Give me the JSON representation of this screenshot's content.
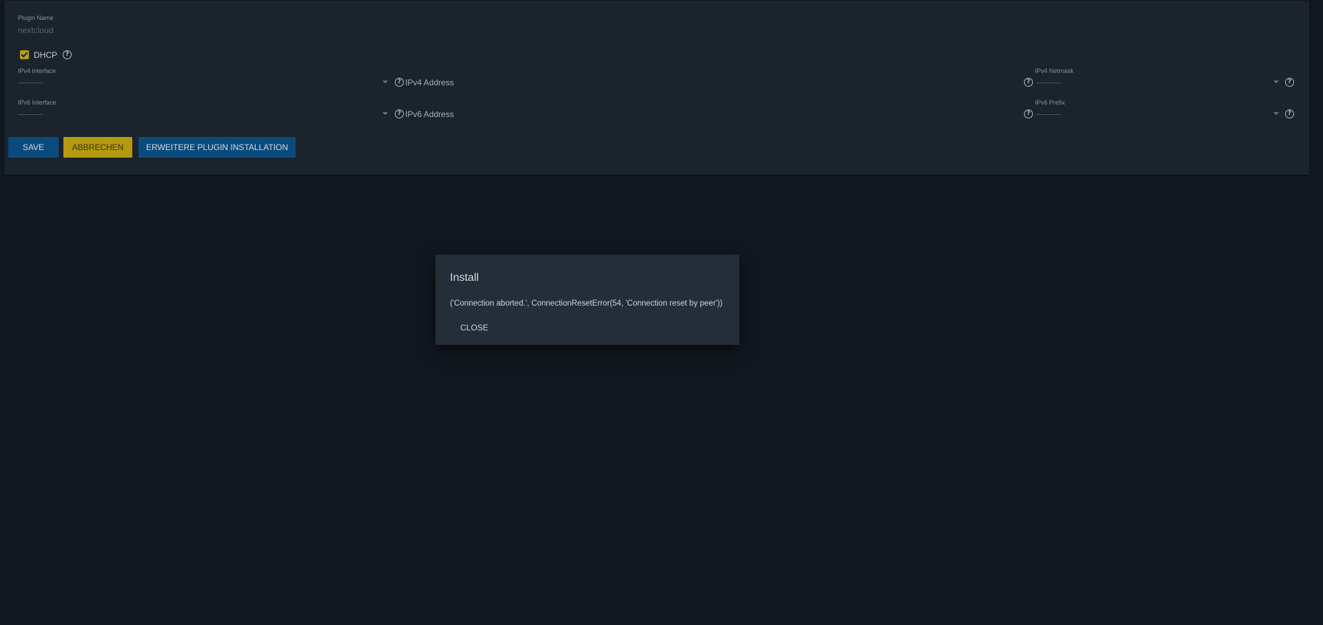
{
  "form": {
    "plugin_name": {
      "label": "Plugin Name",
      "value": "nextcloud"
    },
    "dhcp": {
      "label": "DHCP",
      "checked": true
    },
    "ipv4_interface": {
      "label": "IPv4 interface",
      "value": ""
    },
    "ipv4_address": {
      "label": "IPv4 Address"
    },
    "ipv4_netmask": {
      "label": "IPv4 Netmask",
      "value": ""
    },
    "ipv6_interface": {
      "label": "IPv6 Interface",
      "value": ""
    },
    "ipv6_address": {
      "label": "IPv6 Address"
    },
    "ipv6_prefix": {
      "label": "IPv6 Prefix",
      "value": ""
    },
    "help_glyph": "?"
  },
  "buttons": {
    "save": "SAVE",
    "cancel": "ABBRECHEN",
    "advanced": "ERWEITERE PLUGIN INSTALLATION"
  },
  "dialog": {
    "title": "Install",
    "message": "('Connection aborted.', ConnectionResetError(54, 'Connection reset by peer'))",
    "close": "CLOSE"
  },
  "colors": {
    "background": "#121820",
    "card": "#1b232c",
    "primary": "#0a4b7e",
    "accent": "#b59a10",
    "dialog": "#232e38"
  },
  "icons": {
    "help": "help-circle-icon",
    "dropdown": "chevron-down-icon",
    "checkbox": "check-icon"
  }
}
